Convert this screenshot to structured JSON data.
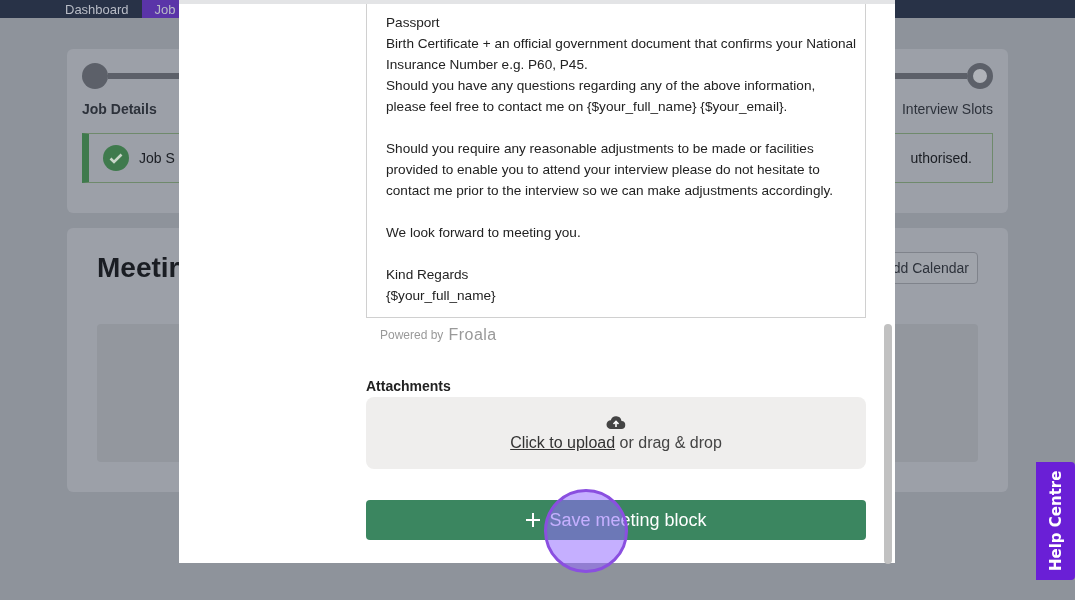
{
  "nav": {
    "items": [
      {
        "label": "Dashboard",
        "selected": false
      },
      {
        "label": "Job",
        "selected": true
      }
    ]
  },
  "progress": {
    "steps": [
      {
        "label": "Job Details",
        "completed": true
      },
      {
        "label": "Interview Slots",
        "completed": false
      }
    ]
  },
  "alert": {
    "text_start": "Job S",
    "text_end": "uthorised."
  },
  "meetings": {
    "title": "Meetir",
    "button": "dd Calendar"
  },
  "modal": {
    "paragraphs": [
      [
        "Passport",
        "Birth Certificate + an official government document that confirms your National",
        "Insurance Number e.g. P60, P45.",
        "Should you have any questions regarding any of the above information,",
        "please feel free to contact me on {$your_full_name} {$your_email}."
      ],
      [
        "Should you require any reasonable adjustments to be made or facilities",
        "provided to enable you to attend your interview please do not hesitate to",
        "contact me prior to the interview so we can make adjustments accordingly."
      ],
      [
        "We look forward to meeting you."
      ],
      [
        "Kind Regards",
        "{$your_full_name}"
      ]
    ],
    "powered_by": "Powered by",
    "brand": "Froala",
    "attachments_label": "Attachments",
    "upload": {
      "link": "Click to upload",
      "text": "or drag & drop"
    },
    "save_button": "Save meeting block"
  },
  "help_button": "Help Centre"
}
